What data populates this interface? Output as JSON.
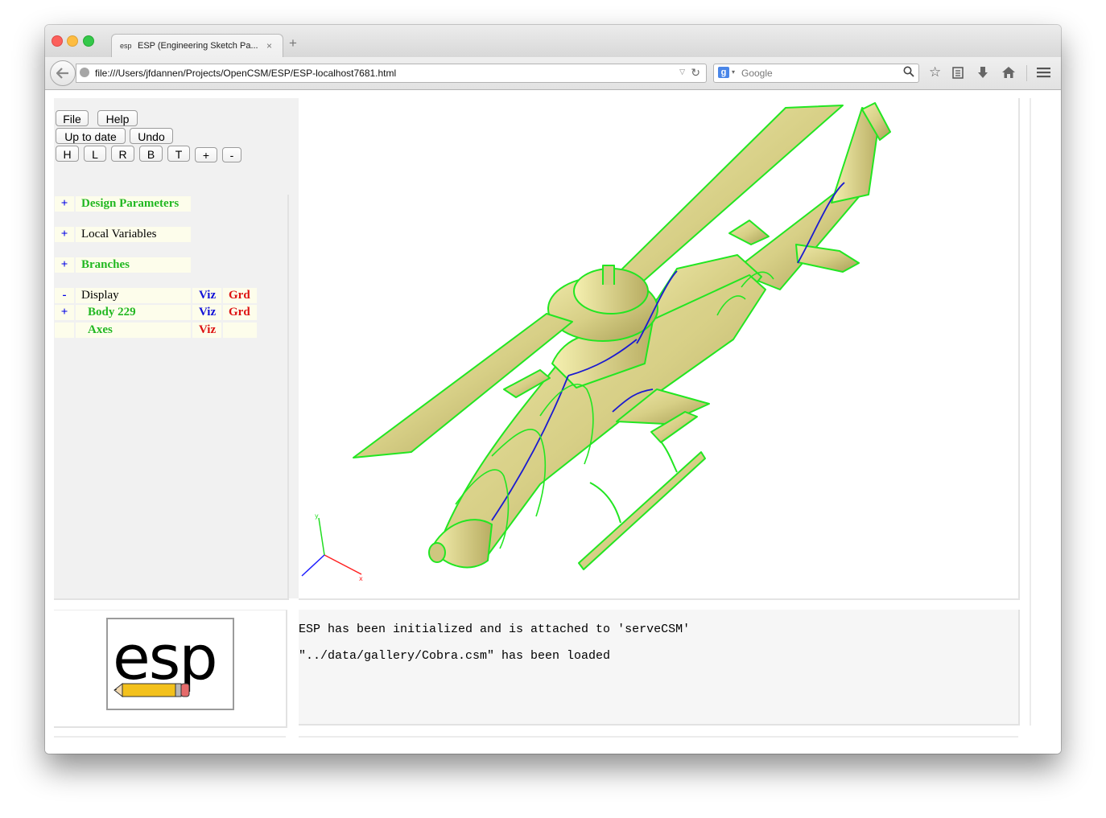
{
  "browser": {
    "tab_title": "ESP (Engineering Sketch Pa...",
    "tab_favicon": "esp",
    "tab_close": "×",
    "new_tab": "+",
    "url": "file:///Users/jfdannen/Projects/OpenCSM/ESP/ESP-localhost7681.html",
    "search_placeholder": "Google",
    "search_engine_icon": "g",
    "icons": {
      "back": "back-arrow-icon",
      "site": "globe-icon",
      "reload": "reload-icon",
      "search": "magnifier-icon",
      "bookmark": "star-icon",
      "reading_list": "clipboard-icon",
      "downloads": "download-arrow-icon",
      "home": "home-icon",
      "menu": "hamburger-menu-icon"
    }
  },
  "toolbar": {
    "file": "File",
    "help": "Help",
    "up_to_date": "Up to date",
    "undo": "Undo",
    "views": [
      "H",
      "L",
      "R",
      "B",
      "T",
      "+",
      "-"
    ]
  },
  "tree": {
    "design_parameters": {
      "toggle": "+",
      "label": "Design Parameters"
    },
    "local_variables": {
      "toggle": "+",
      "label": "Local Variables"
    },
    "branches": {
      "toggle": "+",
      "label": "Branches"
    },
    "display": {
      "toggle": "-",
      "label": "Display",
      "viz": "Viz",
      "grd": "Grd"
    },
    "body": {
      "toggle": "+",
      "label": "Body 229",
      "viz": "Viz",
      "grd": "Grd"
    },
    "axes": {
      "label": "Axes",
      "viz": "Viz"
    }
  },
  "messages": [
    "ESP has been initialized and is attached to 'serveCSM'",
    "\"../data/gallery/Cobra.csm\" has been loaded"
  ],
  "logo": {
    "text": "esp"
  },
  "colors": {
    "edge_green": "#22e622",
    "edge_blue": "#1a1ad0",
    "surface": "#dcd58c",
    "tree_green": "#22b822",
    "tree_blue": "#0000e6",
    "tree_red": "#dd1111"
  }
}
